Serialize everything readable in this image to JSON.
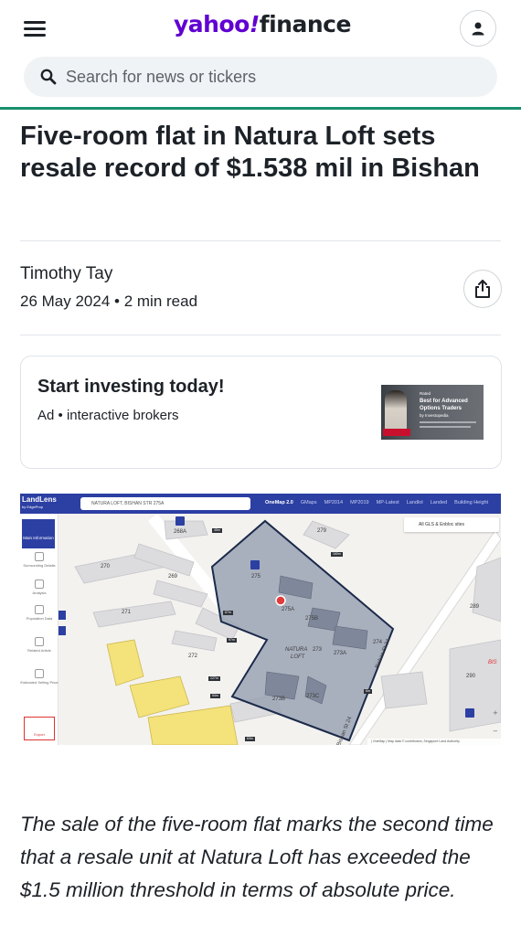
{
  "header": {
    "logo_yahoo": "yahoo",
    "logo_bang": "!",
    "logo_finance": "finance",
    "search_placeholder": "Search for news or tickers",
    "accent_color": "#188f6d",
    "brand_color": "#6001d2"
  },
  "article": {
    "headline": "Five-room flat in Natura Loft sets resale record of $1.538 mil in Bishan",
    "author": "Timothy Tay",
    "date": "26 May 2024",
    "separator": "•",
    "read_time": "2 min read",
    "body": "The sale of the five-room flat marks the second time that a resale unit at Natura Loft has exceeded the $1.5 million threshold in terms of absolute price."
  },
  "ad": {
    "title": "Start investing today!",
    "label": "Ad",
    "separator": "•",
    "sponsor": "interactive brokers",
    "image_line1": "Rated",
    "image_line2": "Best for Advanced",
    "image_line3": "Options Traders",
    "image_line4": "by Investopedia",
    "image_brand": "Interactive Brokers"
  },
  "map": {
    "brand": "LandLens",
    "brand_sub": "by EdgeProp",
    "search_value": "NATURA LOFT, BISHAN STR 275A",
    "tabs": [
      "OneMap 2.0",
      "GMaps",
      "MP2014",
      "MP2019",
      "MP-Latest",
      "Landlot",
      "Landed",
      "Building Height"
    ],
    "filter": "All GLS & Enbloc sites",
    "sidebar": [
      "Main Information",
      "Surrounding Details",
      "Analysis",
      "Population Data",
      "Related Article",
      "Estimated Selling Price",
      "Export"
    ],
    "labels": [
      "268A",
      "279",
      "270",
      "269",
      "275",
      "275A",
      "275B",
      "271",
      "272",
      "289",
      "NATURA",
      "LOFT",
      "273",
      "273A",
      "274",
      "273B",
      "273C",
      "290",
      "Bishan St 24",
      "Bishan St 24",
      "BIS"
    ],
    "attribution": "| OneMap | Map data © contributors, Singapore Land Authority"
  }
}
